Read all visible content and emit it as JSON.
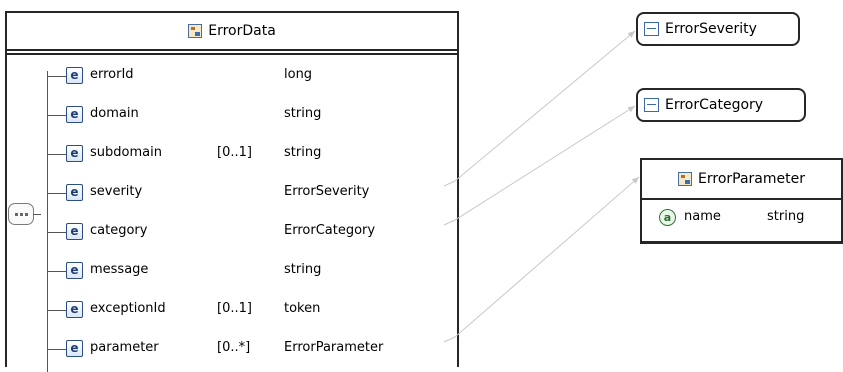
{
  "main_type": {
    "name": "ErrorData",
    "elements": [
      {
        "name": "errorId",
        "occurs": "",
        "type": "long"
      },
      {
        "name": "domain",
        "occurs": "",
        "type": "string"
      },
      {
        "name": "subdomain",
        "occurs": "[0..1]",
        "type": "string"
      },
      {
        "name": "severity",
        "occurs": "",
        "type": "ErrorSeverity"
      },
      {
        "name": "category",
        "occurs": "",
        "type": "ErrorCategory"
      },
      {
        "name": "message",
        "occurs": "",
        "type": "string"
      },
      {
        "name": "exceptionId",
        "occurs": "[0..1]",
        "type": "token"
      },
      {
        "name": "parameter",
        "occurs": "[0..*]",
        "type": "ErrorParameter"
      }
    ],
    "element_icon_letter": "e"
  },
  "simple_types": [
    {
      "name": "ErrorSeverity"
    },
    {
      "name": "ErrorCategory"
    }
  ],
  "param_type": {
    "name": "ErrorParameter",
    "attribute": {
      "icon_letter": "a",
      "name": "name",
      "type": "string"
    }
  },
  "colors": {
    "border": "#262626",
    "connector": "#c8c8c8",
    "element_icon": "#1d3f78",
    "attribute_icon": "#2c6b2c"
  }
}
